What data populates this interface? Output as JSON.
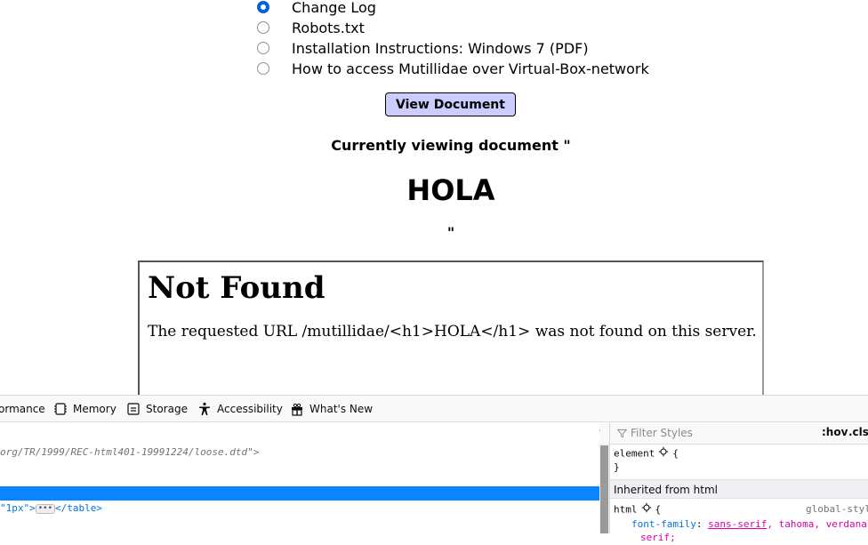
{
  "documents": {
    "options": [
      {
        "label": "Change Log",
        "checked": true
      },
      {
        "label": "Robots.txt",
        "checked": false
      },
      {
        "label": "Installation Instructions: Windows 7 (PDF)",
        "checked": false
      },
      {
        "label": "How to access Mutillidae over Virtual-Box-network",
        "checked": false
      }
    ],
    "view_button": "View Document",
    "currently_viewing": "Currently viewing document \"",
    "injected_heading": "HOLA",
    "closing_quote": "\""
  },
  "frame": {
    "heading": "Not Found",
    "message": "The requested URL /mutillidae/<h1>HOLA</h1> was not found on this server."
  },
  "devtools": {
    "tabs": [
      {
        "label": "ormance",
        "icon": "performance-icon"
      },
      {
        "label": "Memory",
        "icon": "memory-icon"
      },
      {
        "label": "Storage",
        "icon": "storage-icon"
      },
      {
        "label": "Accessibility",
        "icon": "accessibility-icon"
      },
      {
        "label": "What's New",
        "icon": "gift-icon"
      }
    ],
    "markup": {
      "doctype_line": "org/TR/1999/REC-html401-19991224/loose.dtd\">",
      "table_line_attr": "\"1px\">",
      "table_line_close": "</table>",
      "ellipsis": "•••"
    },
    "rules": {
      "filter_placeholder": "Filter Styles",
      "hov": ":hov",
      "cls": ".cls",
      "element_selector": "element",
      "open_brace": "{",
      "close_brace": "}",
      "inherited_label": "Inherited from html",
      "html_selector": "html",
      "source": "global-styl",
      "prop_name": "font-family",
      "prop_value_link": "sans-serif",
      "prop_value_rest": ", tahoma, verdana",
      "prop_value_next": "serif;"
    }
  },
  "colors": {
    "button_bg": "#ccccff",
    "selection": "#0a84ff",
    "radio_checked": "#0060df"
  }
}
